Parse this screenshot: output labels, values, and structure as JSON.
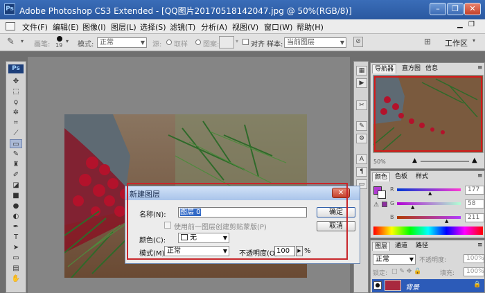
{
  "window": {
    "icon_text": "Ps",
    "title": "Adobe Photoshop CS3 Extended - [QQ图片20170518142047.jpg @ 50%(RGB/8)]",
    "min_label": "–",
    "max_label": "❐",
    "close_label": "✕"
  },
  "menu": [
    "文件(F)",
    "编辑(E)",
    "图像(I)",
    "图层(L)",
    "选择(S)",
    "滤镜(T)",
    "分析(A)",
    "视图(V)",
    "窗口(W)",
    "帮助(H)"
  ],
  "options": {
    "brush_label": "画笔:",
    "brush_size": "19",
    "mode_label": "模式:",
    "mode_value": "正常",
    "source_label": "源:",
    "sampled_label": "取样",
    "pattern_label": "图案:",
    "aligned_label": "对齐",
    "sample_label": "样本:",
    "sample_value": "当前图层",
    "workspace_label": "工作区"
  },
  "toolbox": {
    "logo": "Ps"
  },
  "navigator": {
    "tabs": [
      "导航器",
      "直方图",
      "信息"
    ],
    "zoom": "50%"
  },
  "color_panel": {
    "tabs": [
      "颜色",
      "色板",
      "样式"
    ],
    "r_label": "R",
    "g_label": "G",
    "b_label": "B",
    "r_value": "177",
    "g_value": "58",
    "b_value": "211",
    "foreground_color": "#b13ad3"
  },
  "layers_panel": {
    "tabs": [
      "图层",
      "通道",
      "路径"
    ],
    "mode": "正常",
    "opacity_label": "不透明度:",
    "opacity_value": "100%",
    "lock_label": "锁定:",
    "fill_label": "填充:",
    "fill_value": "100%",
    "layer_name": "背景"
  },
  "dialog": {
    "title": "新建图层",
    "name_label": "名称(N):",
    "name_value": "图层 0",
    "clip_label": "使用前一图层创建剪贴蒙版(P)",
    "color_label": "颜色(C):",
    "color_value": "无",
    "mode_label": "模式(M):",
    "mode_value": "正常",
    "opacity_label": "不透明度(O):",
    "opacity_value": "100",
    "percent": "%",
    "ok_label": "确定",
    "cancel_label": "取消"
  }
}
